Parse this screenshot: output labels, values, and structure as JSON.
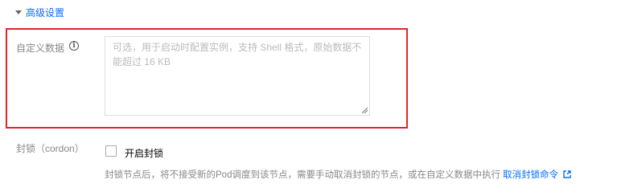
{
  "advanced": {
    "toggle_label": "高级设置"
  },
  "user_data": {
    "label": "自定义数据",
    "info_icon": "info-icon",
    "placeholder": "可选，用于启动时配置实例，支持 Shell 格式，原始数据不能超过 16 KB"
  },
  "cordon": {
    "label": "封锁（cordon）",
    "checkbox_label": "开启封锁",
    "checked": false,
    "hint_text": "封锁节点后，将不接受新的Pod调度到该节点，需要手动取消封锁的节点，或在自定义数据中执行",
    "hint_link": "取消封锁命令",
    "link_icon": "external-link-icon"
  },
  "colors": {
    "accent": "#006eff",
    "highlight": "#e1242b",
    "muted": "#888888"
  }
}
